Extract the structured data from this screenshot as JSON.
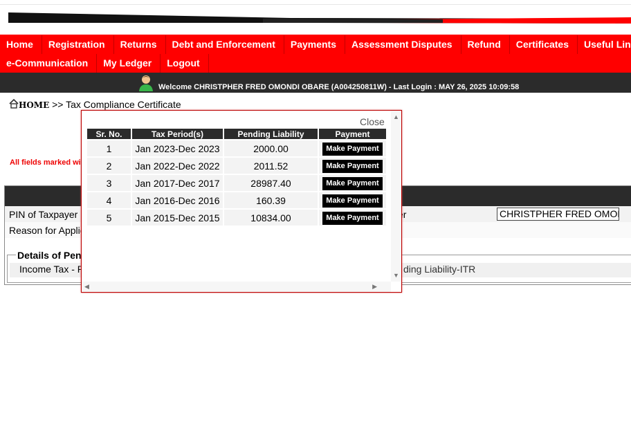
{
  "nav": {
    "row1": [
      "Home",
      "Registration",
      "Returns",
      "Debt and Enforcement",
      "Payments",
      "Assessment Disputes",
      "Refund",
      "Certificates",
      "Useful Links"
    ],
    "row2": [
      "e-Communication",
      "My Ledger",
      "Logout"
    ]
  },
  "welcome": {
    "text": "Welcome CHRISTPHER FRED OMONDI OBARE (A004250811W)  - Last Login : MAY 26, 2025 10:09:58"
  },
  "breadcrumb": {
    "home": "HOME",
    "separator": ">>",
    "current": "Tax Compliance Certificate"
  },
  "form": {
    "required_note": "All fields marked with",
    "pin_label": "PIN of Taxpayer",
    "reason_label": "Reason for Applic",
    "name_label_tail": "er",
    "name_value": "CHRISTPHER FRED OMONDI OBARE",
    "details_legend": "Details of Pend",
    "tab_income": "Income Tax - Re",
    "tab_pending": "ding Liability-ITR"
  },
  "popup": {
    "close_label": "Close",
    "headers": [
      "Sr. No.",
      "Tax Period(s)",
      "Pending Liability",
      "Payment"
    ],
    "button_label": "Make Payment",
    "rows": [
      {
        "sr": "1",
        "period": "Jan 2023-Dec 2023",
        "liability": "2000.00"
      },
      {
        "sr": "2",
        "period": "Jan 2022-Dec 2022",
        "liability": "2011.52"
      },
      {
        "sr": "3",
        "period": "Jan 2017-Dec 2017",
        "liability": "28987.40"
      },
      {
        "sr": "4",
        "period": "Jan 2016-Dec 2016",
        "liability": "160.39"
      },
      {
        "sr": "5",
        "period": "Jan 2015-Dec 2015",
        "liability": "10834.00"
      }
    ]
  },
  "colors": {
    "nav_bg": "#ff0000",
    "dark_bar": "#2b2b2b",
    "required_text": "#ee0000"
  }
}
